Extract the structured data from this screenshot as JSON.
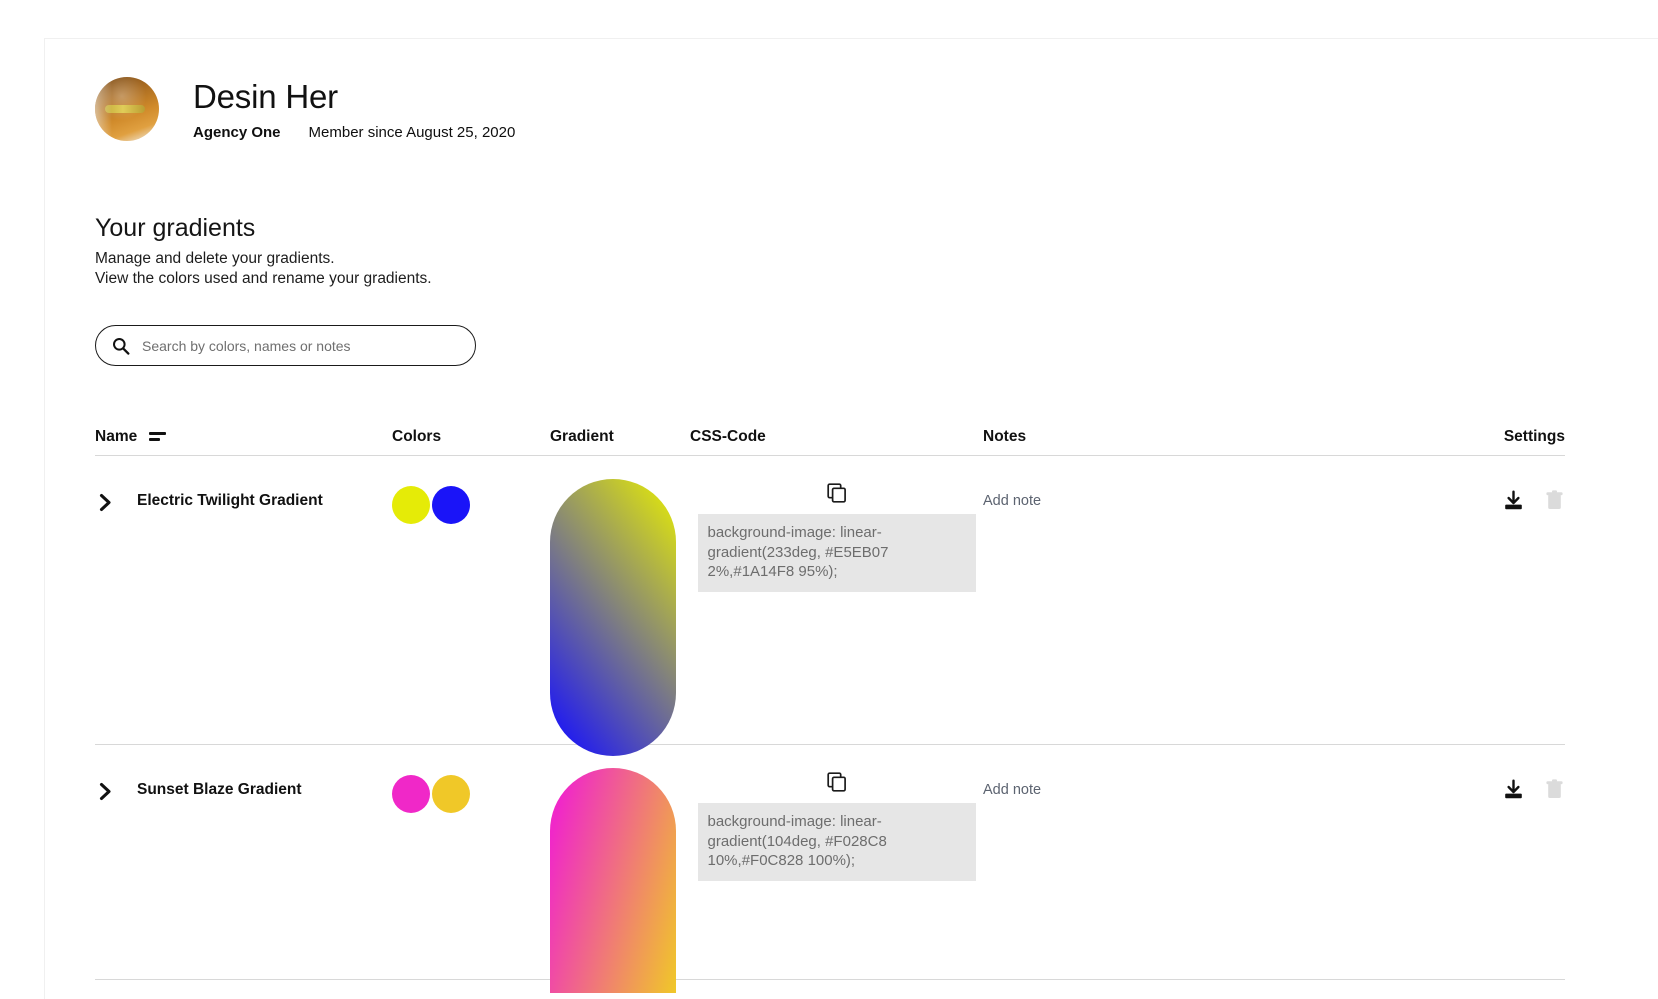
{
  "profile": {
    "name": "Desin Her",
    "agency": "Agency One",
    "member_since": "Member since August 25, 2020",
    "avatar_icon": "user-avatar-photo"
  },
  "section": {
    "title": "Your gradients",
    "subtitle_line1": "Manage and delete your gradients.",
    "subtitle_line2": "View the colors used and rename your gradients."
  },
  "search": {
    "placeholder": "Search by colors, names or notes",
    "value": "",
    "icon": "search-icon"
  },
  "table": {
    "headers": {
      "name": "Name",
      "colors": "Colors",
      "gradient": "Gradient",
      "css_code": "CSS-Code",
      "notes": "Notes",
      "settings": "Settings"
    },
    "sort_icon": "sort-lines-icon",
    "rows": [
      {
        "name": "Electric Twilight Gradient",
        "expand_icon": "chevron-right-icon",
        "colors": [
          "#E5EB07",
          "#1A14F8"
        ],
        "gradient_css": "linear-gradient(233deg, #E5EB07 2%,#1A14F8 95%)",
        "css_code": "background-image: linear-gradient(233deg, #E5EB07 2%,#1A14F8 95%);",
        "copy_icon": "copy-icon",
        "note_placeholder": "Add note",
        "download_icon": "download-icon",
        "delete_icon": "trash-icon"
      },
      {
        "name": "Sunset Blaze Gradient",
        "expand_icon": "chevron-right-icon",
        "colors": [
          "#F028C8",
          "#F0C828"
        ],
        "gradient_css": "linear-gradient(104deg, #F028C8 10%,#F0C828 100%)",
        "css_code": "background-image: linear-gradient(104deg, #F028C8 10%,#F0C828 100%);",
        "copy_icon": "copy-icon",
        "note_placeholder": "Add note",
        "download_icon": "download-icon",
        "delete_icon": "trash-icon"
      }
    ]
  },
  "colors": {
    "page_background": "#FFFFFF",
    "text_primary": "#111111",
    "code_background": "#E6E6E6",
    "code_text": "#6D6D6D",
    "note_text": "#5C6370",
    "divider": "#D8D8D8"
  }
}
